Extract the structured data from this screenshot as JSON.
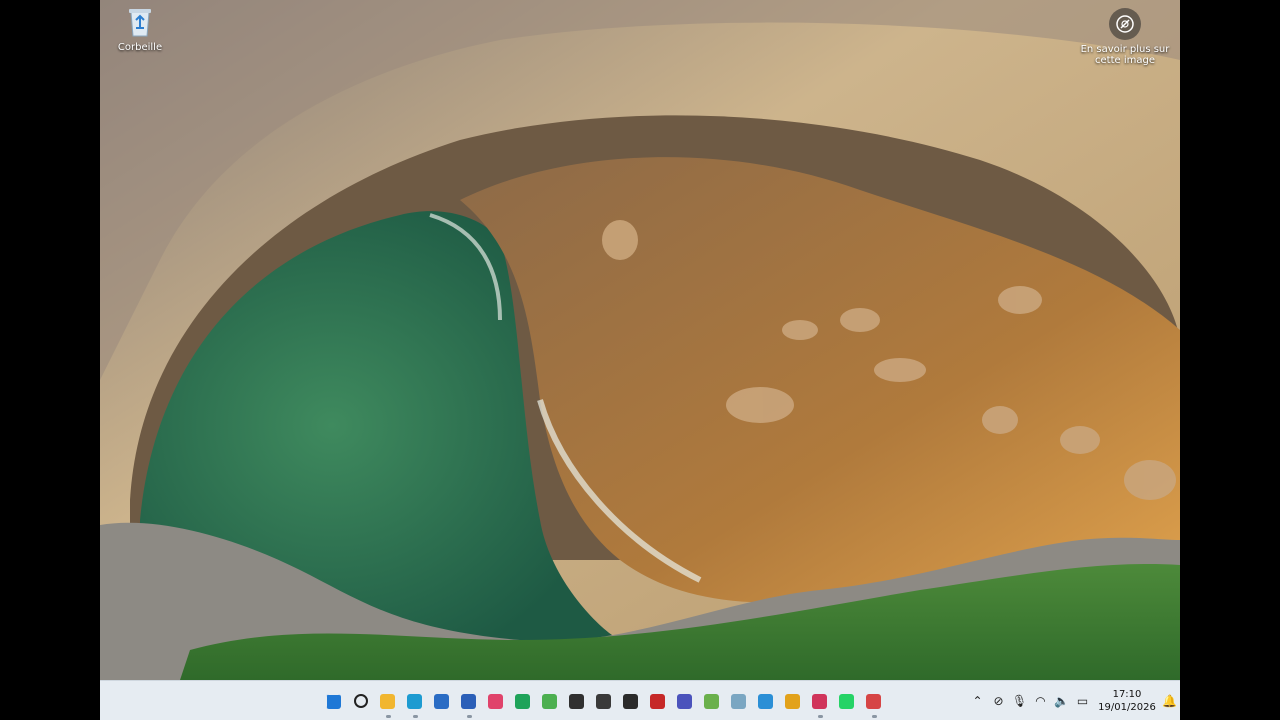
{
  "desktop": {
    "icons": [
      {
        "label": "Corbeille",
        "icon": "recycle-bin-icon"
      }
    ],
    "spotlight": {
      "label": "En savoir plus sur cette image",
      "icon": "camera-info-icon"
    }
  },
  "taskbar": {
    "apps": [
      {
        "name": "start",
        "icon": "windows-logo-icon",
        "color": "#1f78d6",
        "running": false
      },
      {
        "name": "search",
        "icon": "search-icon",
        "color": "#222222",
        "running": false
      },
      {
        "name": "file-explorer",
        "icon": "folder-icon",
        "color": "#f1b630",
        "running": true
      },
      {
        "name": "edge",
        "icon": "edge-browser-icon",
        "color": "#1d9bd1",
        "running": true
      },
      {
        "name": "microsoft-store",
        "icon": "store-icon",
        "color": "#2a6cc4",
        "running": false
      },
      {
        "name": "thunderbird",
        "icon": "mail-icon",
        "color": "#2b5fb8",
        "running": true
      },
      {
        "name": "music",
        "icon": "music-icon",
        "color": "#e0436b",
        "running": false
      },
      {
        "name": "chat",
        "icon": "chat-bubbles-icon",
        "color": "#1fa35a",
        "running": false
      },
      {
        "name": "photos",
        "icon": "photos-icon",
        "color": "#4caf50",
        "running": false
      },
      {
        "name": "obs",
        "icon": "record-icon",
        "color": "#303030",
        "running": false
      },
      {
        "name": "security",
        "icon": "shield-icon",
        "color": "#3a3a3a",
        "running": false
      },
      {
        "name": "terminal",
        "icon": "terminal-icon",
        "color": "#2b2b2b",
        "running": false
      },
      {
        "name": "filezilla",
        "icon": "filezilla-icon",
        "color": "#c62828",
        "running": false
      },
      {
        "name": "teams",
        "icon": "people-icon",
        "color": "#4b53bc",
        "running": false
      },
      {
        "name": "notepad-plus",
        "icon": "chameleon-icon",
        "color": "#6ab04c",
        "running": false
      },
      {
        "name": "paint",
        "icon": "palette-icon",
        "color": "#7aa6c2",
        "running": false
      },
      {
        "name": "calculator",
        "icon": "calculator-icon",
        "color": "#2b8fd6",
        "running": false
      },
      {
        "name": "task-manager",
        "icon": "chart-window-icon",
        "color": "#e2a21b",
        "running": false
      },
      {
        "name": "snipping-tool",
        "icon": "scissors-icon",
        "color": "#d0345b",
        "running": true
      },
      {
        "name": "whatsapp",
        "icon": "whatsapp-icon",
        "color": "#25d366",
        "running": false
      },
      {
        "name": "network-tool",
        "icon": "network-icon",
        "color": "#d64545",
        "running": true
      }
    ],
    "tray": [
      {
        "name": "show-hidden",
        "icon": "chevron-up-icon",
        "glyph": "⌃"
      },
      {
        "name": "location-off",
        "icon": "eye-off-icon",
        "glyph": "⊘"
      },
      {
        "name": "microphone",
        "icon": "microphone-icon",
        "glyph": "🎙"
      },
      {
        "name": "wifi",
        "icon": "wifi-icon",
        "glyph": "◠"
      },
      {
        "name": "volume",
        "icon": "speaker-icon",
        "glyph": "🔈"
      },
      {
        "name": "battery",
        "icon": "battery-icon",
        "glyph": "▭"
      }
    ],
    "clock": {
      "time": "17:10",
      "date": "19/01/2026"
    },
    "notifications": {
      "icon": "bell-icon",
      "glyph": "🔔"
    }
  }
}
